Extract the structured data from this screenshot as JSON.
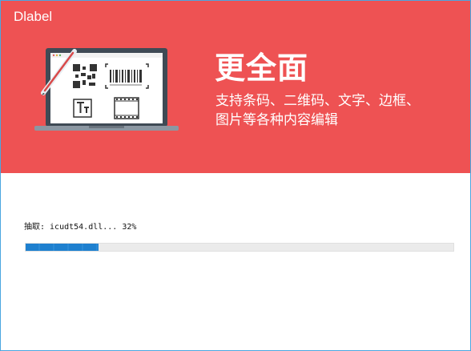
{
  "window": {
    "title": "Dlabel"
  },
  "banner": {
    "headline": "更全面",
    "feature_line_1": "支持条码、二维码、文字、边框、",
    "feature_line_2": "图片等各种内容编辑",
    "background_color": "#ee5253",
    "illustration_icons": [
      "laptop-icon",
      "pen-icon",
      "qr-code-icon",
      "barcode-icon",
      "text-icon",
      "film-strip-icon"
    ]
  },
  "progress": {
    "status_text": "抽取: icudt54.dll... 32%",
    "fraction": 0.17,
    "fill_color": "#1e80cf"
  }
}
